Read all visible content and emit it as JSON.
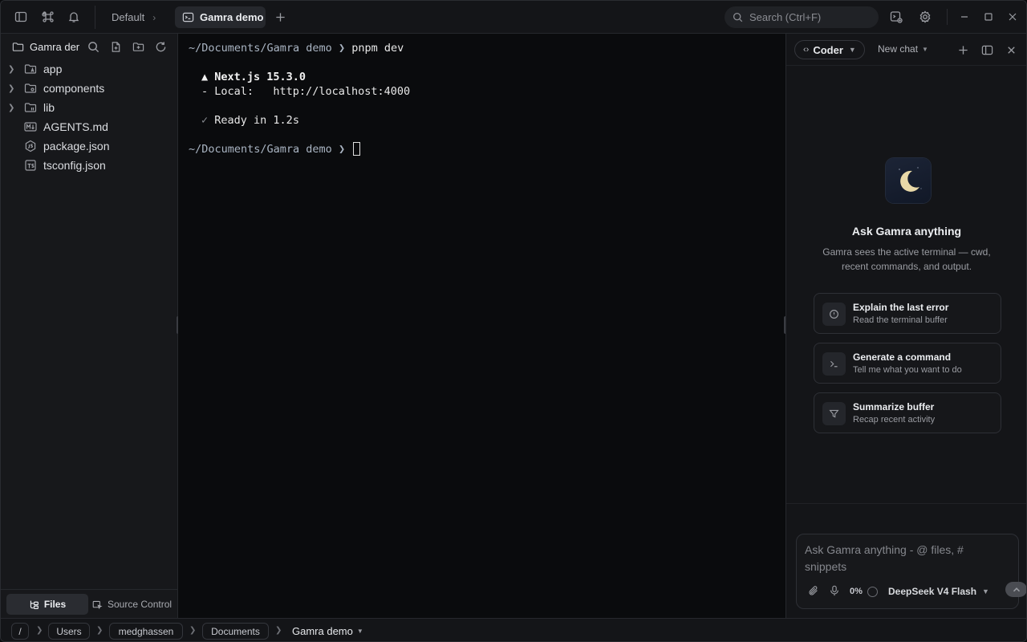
{
  "tabs": {
    "default_label": "Default",
    "active_label": "Gamra demo"
  },
  "search": {
    "placeholder": "Search (Ctrl+F)"
  },
  "sidebar": {
    "title": "Gamra demo",
    "tree": [
      {
        "name": "app",
        "type": "folder"
      },
      {
        "name": "components",
        "type": "folder"
      },
      {
        "name": "lib",
        "type": "folder"
      },
      {
        "name": "AGENTS.md",
        "type": "markdown"
      },
      {
        "name": "package.json",
        "type": "json"
      },
      {
        "name": "tsconfig.json",
        "type": "ts-config"
      }
    ],
    "footer": {
      "files_label": "Files",
      "source_control_label": "Source Control"
    }
  },
  "terminal": {
    "prompt_cwd": "~/Documents/Gamra demo",
    "prompt_arrow": "❯",
    "command": "pnpm dev",
    "line_next": "▲ Next.js 15.3.0",
    "line_local_label": "- Local:",
    "line_local_url": "http://localhost:4000",
    "ready_check": "✓",
    "ready_text": "Ready in 1.2s"
  },
  "assistant": {
    "mode_label": "Coder",
    "new_chat_label": "New chat",
    "title": "Ask Gamra anything",
    "subtitle": "Gamra sees the active terminal — cwd, recent commands, and output.",
    "suggestions": [
      {
        "title": "Explain the last error",
        "desc": "Read the terminal buffer",
        "icon": "alert-circle-icon"
      },
      {
        "title": "Generate a command",
        "desc": "Tell me what you want to do",
        "icon": "terminal-prompt-icon"
      },
      {
        "title": "Summarize buffer",
        "desc": "Recap recent activity",
        "icon": "filter-icon"
      }
    ],
    "input_placeholder": "Ask Gamra anything  -  @ files, # snippets",
    "context_percent": "0%",
    "model": "DeepSeek V4 Flash"
  },
  "breadcrumb": [
    "/",
    "Users",
    "medghassen",
    "Documents",
    "Gamra demo"
  ],
  "colors": {
    "background": "#0a0b0d",
    "panel": "#141518",
    "accent_moon": "#e9d9a8"
  }
}
